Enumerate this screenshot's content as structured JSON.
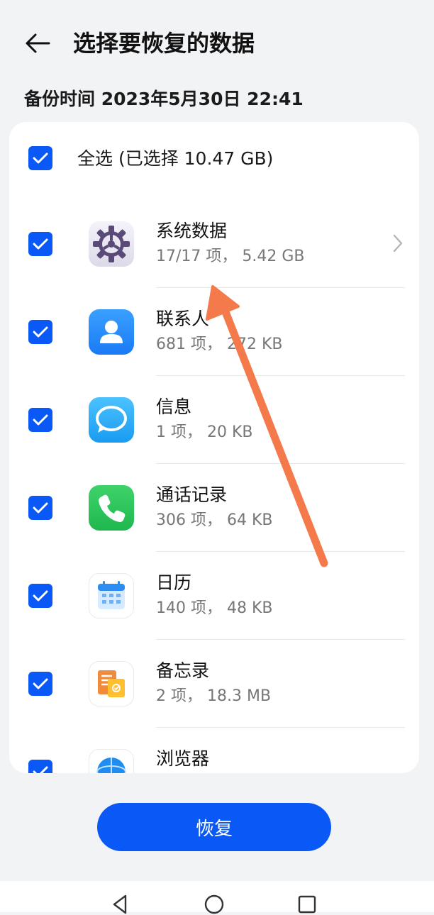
{
  "header": {
    "title": "选择要恢复的数据"
  },
  "backup_time": "备份时间 2023年5月30日 22:41",
  "select_all": {
    "label": "全选 (已选择 10.47 GB)",
    "checked": true
  },
  "items": [
    {
      "name": "系统数据",
      "meta": "17/17 项， 5.42 GB",
      "icon": "gear-icon",
      "checked": true,
      "has_chevron": true
    },
    {
      "name": "联系人",
      "meta": "681 项， 272 KB",
      "icon": "contacts-icon",
      "checked": true
    },
    {
      "name": "信息",
      "meta": "1 项， 20 KB",
      "icon": "message-icon",
      "checked": true
    },
    {
      "name": "通话记录",
      "meta": "306 项， 64 KB",
      "icon": "phone-icon",
      "checked": true
    },
    {
      "name": "日历",
      "meta": "140 项， 48 KB",
      "icon": "calendar-icon",
      "checked": true
    },
    {
      "name": "备忘录",
      "meta": "2 项， 18.3 MB",
      "icon": "notes-icon",
      "checked": true
    },
    {
      "name": "浏览器",
      "meta": "",
      "icon": "browser-icon",
      "checked": true
    }
  ],
  "restore_button": {
    "label": "恢复"
  },
  "colors": {
    "accent": "#0a59f7",
    "background": "#f1f3f5",
    "annotation_arrow": "#f47a4c"
  }
}
